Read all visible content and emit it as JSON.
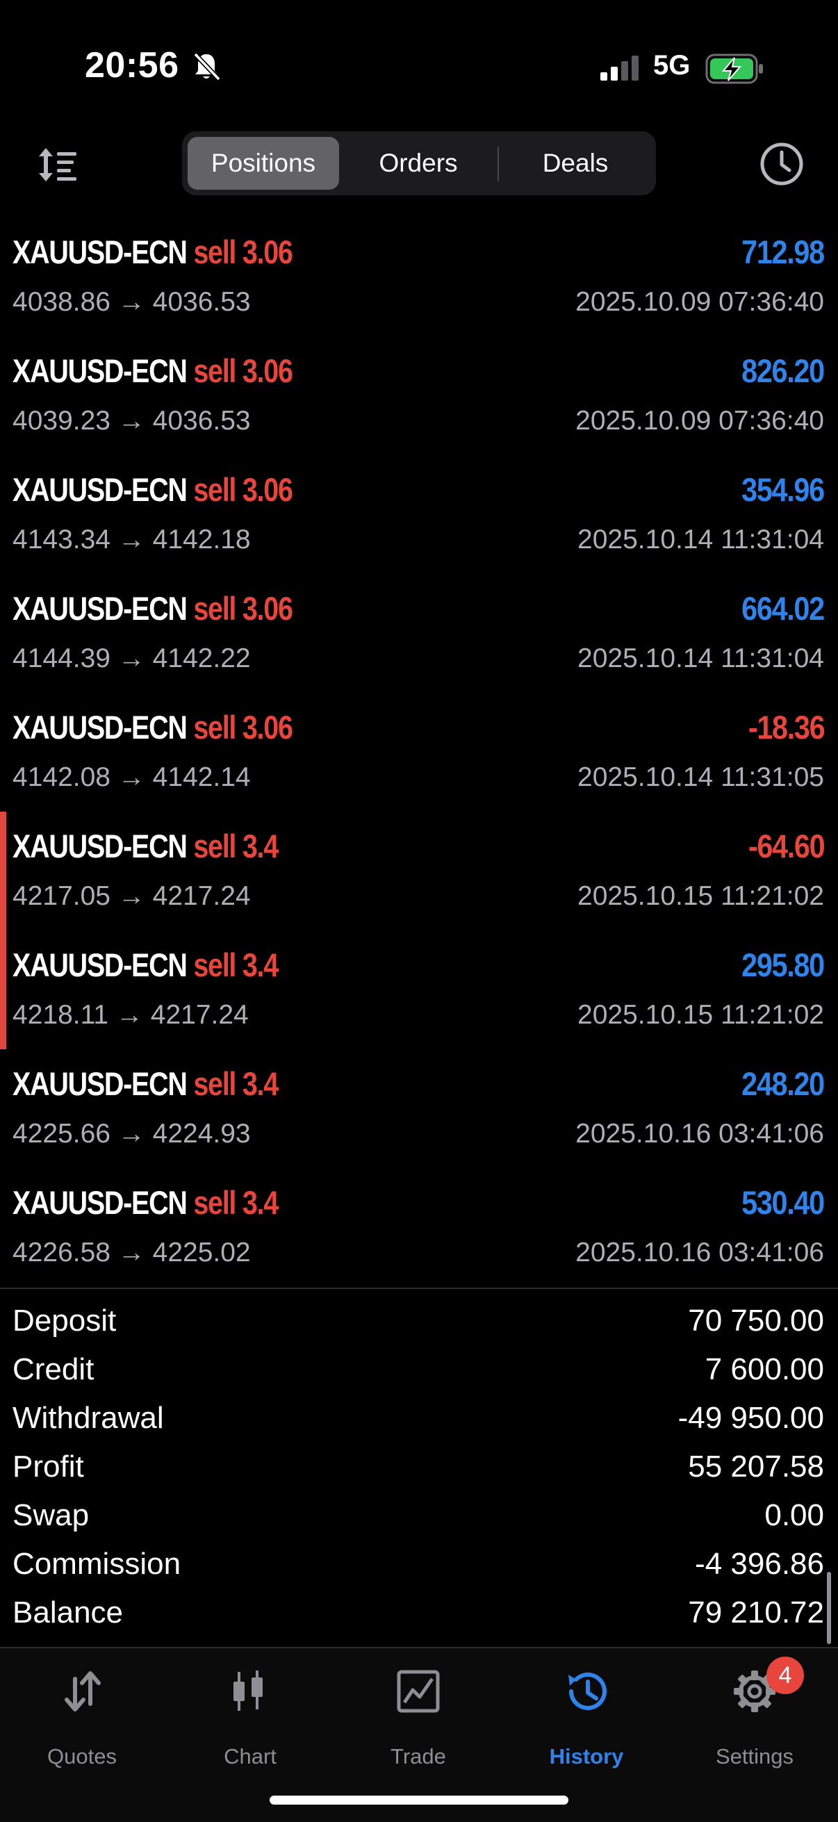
{
  "status_bar": {
    "time": "20:56",
    "network": "5G"
  },
  "toolbar": {
    "tabs": [
      {
        "label": "Positions",
        "active": true
      },
      {
        "label": "Orders",
        "active": false
      },
      {
        "label": "Deals",
        "active": false
      }
    ]
  },
  "deals": [
    {
      "symbol": "XAUUSD-ECN",
      "type": "sell 3.06",
      "profit": "712.98",
      "positive": true,
      "prices": "4038.86 → 4036.53",
      "time": "2025.10.09 07:36:40",
      "marked": false
    },
    {
      "symbol": "XAUUSD-ECN",
      "type": "sell 3.06",
      "profit": "826.20",
      "positive": true,
      "prices": "4039.23 → 4036.53",
      "time": "2025.10.09 07:36:40",
      "marked": false
    },
    {
      "symbol": "XAUUSD-ECN",
      "type": "sell 3.06",
      "profit": "354.96",
      "positive": true,
      "prices": "4143.34 → 4142.18",
      "time": "2025.10.14 11:31:04",
      "marked": false
    },
    {
      "symbol": "XAUUSD-ECN",
      "type": "sell 3.06",
      "profit": "664.02",
      "positive": true,
      "prices": "4144.39 → 4142.22",
      "time": "2025.10.14 11:31:04",
      "marked": false
    },
    {
      "symbol": "XAUUSD-ECN",
      "type": "sell 3.06",
      "profit": "-18.36",
      "positive": false,
      "prices": "4142.08 → 4142.14",
      "time": "2025.10.14 11:31:05",
      "marked": false
    },
    {
      "symbol": "XAUUSD-ECN",
      "type": "sell 3.4",
      "profit": "-64.60",
      "positive": false,
      "prices": "4217.05 → 4217.24",
      "time": "2025.10.15 11:21:02",
      "marked": true
    },
    {
      "symbol": "XAUUSD-ECN",
      "type": "sell 3.4",
      "profit": "295.80",
      "positive": true,
      "prices": "4218.11 → 4217.24",
      "time": "2025.10.15 11:21:02",
      "marked": true
    },
    {
      "symbol": "XAUUSD-ECN",
      "type": "sell 3.4",
      "profit": "248.20",
      "positive": true,
      "prices": "4225.66 → 4224.93",
      "time": "2025.10.16 03:41:06",
      "marked": false
    },
    {
      "symbol": "XAUUSD-ECN",
      "type": "sell 3.4",
      "profit": "530.40",
      "positive": true,
      "prices": "4226.58 → 4225.02",
      "time": "2025.10.16 03:41:06",
      "marked": false
    }
  ],
  "summary": [
    {
      "label": "Deposit",
      "value": "70 750.00"
    },
    {
      "label": "Credit",
      "value": "7 600.00"
    },
    {
      "label": "Withdrawal",
      "value": "-49 950.00"
    },
    {
      "label": "Profit",
      "value": "55 207.58"
    },
    {
      "label": "Swap",
      "value": "0.00"
    },
    {
      "label": "Commission",
      "value": "-4 396.86"
    },
    {
      "label": "Balance",
      "value": "79 210.72"
    }
  ],
  "tab_bar": {
    "tabs": [
      {
        "label": "Quotes",
        "icon": "quotes-arrows-icon",
        "active": false
      },
      {
        "label": "Chart",
        "icon": "candlestick-chart-icon",
        "active": false
      },
      {
        "label": "Trade",
        "icon": "trade-chart-icon",
        "active": false
      },
      {
        "label": "History",
        "icon": "history-clock-icon",
        "active": true
      },
      {
        "label": "Settings",
        "icon": "gear-icon",
        "active": false
      }
    ],
    "settings_badge": "4"
  },
  "colors": {
    "accent": "#2f83e9",
    "negative": "#e8453c",
    "background": "#000000"
  }
}
